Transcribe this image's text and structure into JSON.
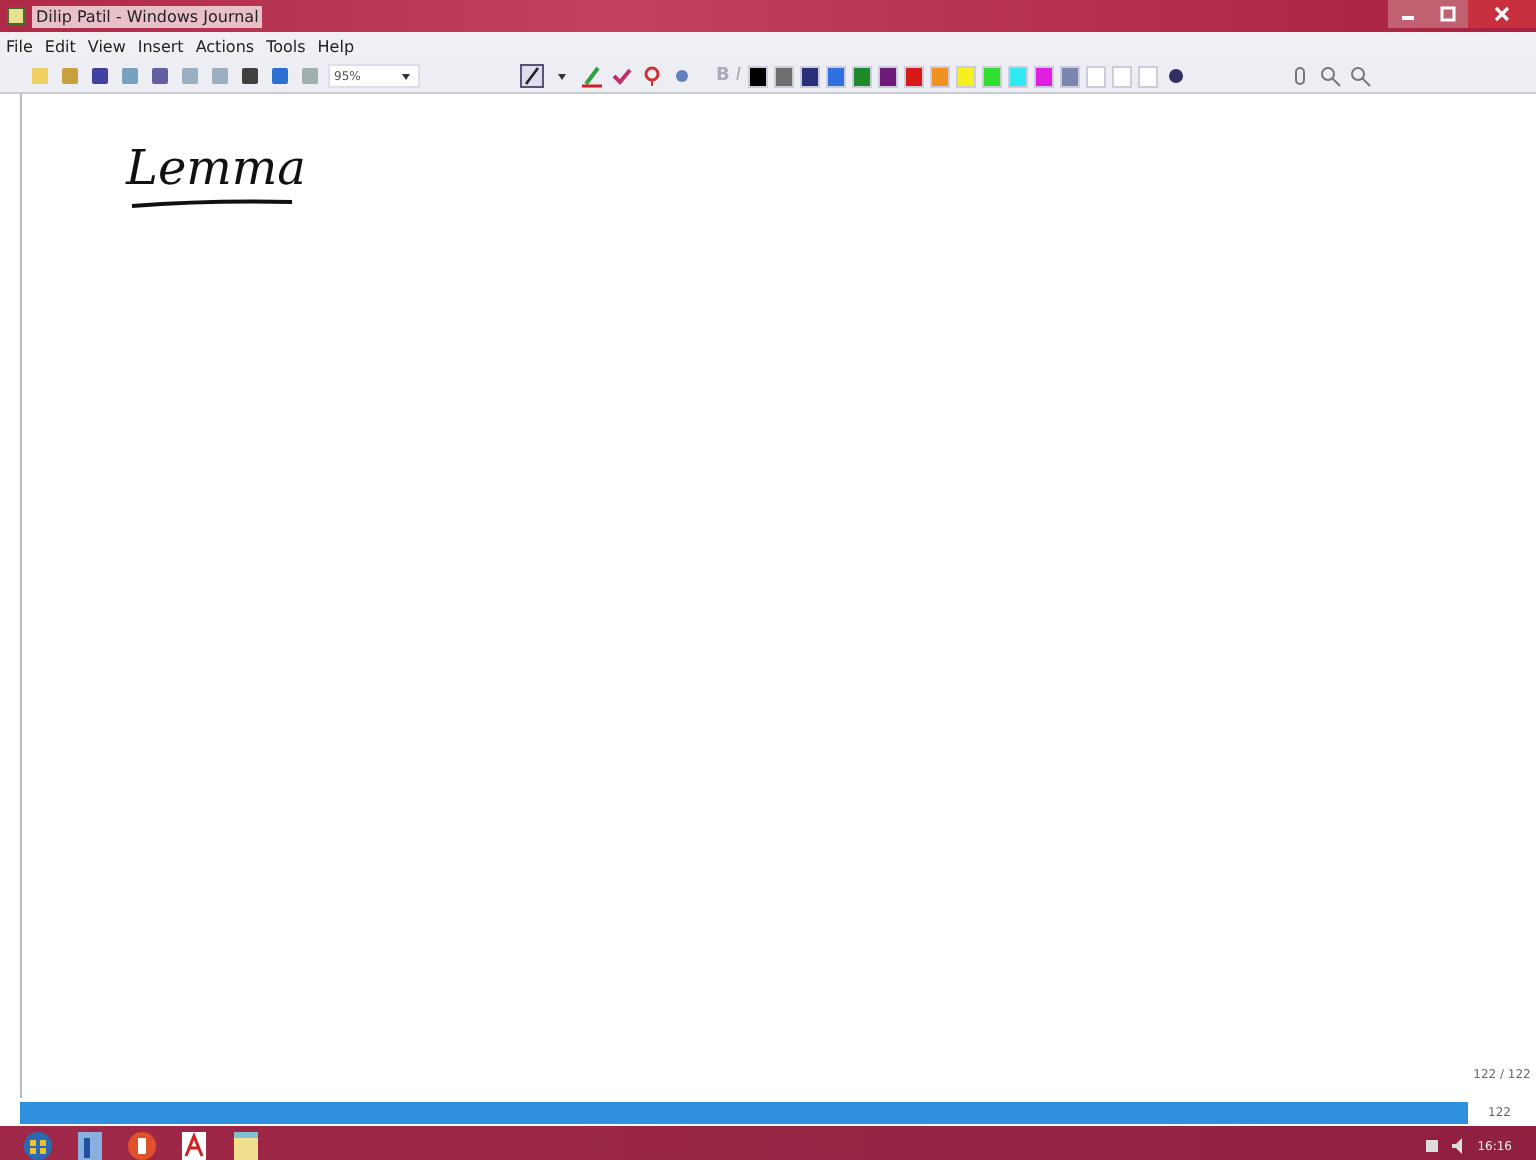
{
  "window": {
    "title": "Dilip Patil - Windows Journal"
  },
  "menu": [
    "File",
    "Edit",
    "View",
    "Insert",
    "Actions",
    "Tools",
    "Help"
  ],
  "toolbar": {
    "zoom": "95%",
    "bold": "B",
    "italic": "I"
  },
  "palette": [
    {
      "color": "#000000"
    },
    {
      "color": "#6e6e6e"
    },
    {
      "color": "#2a2f7a"
    },
    {
      "color": "#2f6fe0"
    },
    {
      "color": "#1f8a2a"
    },
    {
      "color": "#6e1b7a"
    },
    {
      "color": "#d81818"
    },
    {
      "color": "#f09020"
    },
    {
      "color": "#f6f020"
    },
    {
      "color": "#30e030"
    },
    {
      "color": "#30e8f0"
    },
    {
      "color": "#e020e0"
    },
    {
      "color": "#7a86b0"
    },
    {
      "color": "#ffffff"
    },
    {
      "color": "#ffffff"
    },
    {
      "color": "#ffffff"
    }
  ],
  "page": {
    "ink_text": "Lemma"
  },
  "status": {
    "page_count": "122 / 122",
    "page_number": "122"
  },
  "taskbar": {
    "time": "16:16"
  }
}
